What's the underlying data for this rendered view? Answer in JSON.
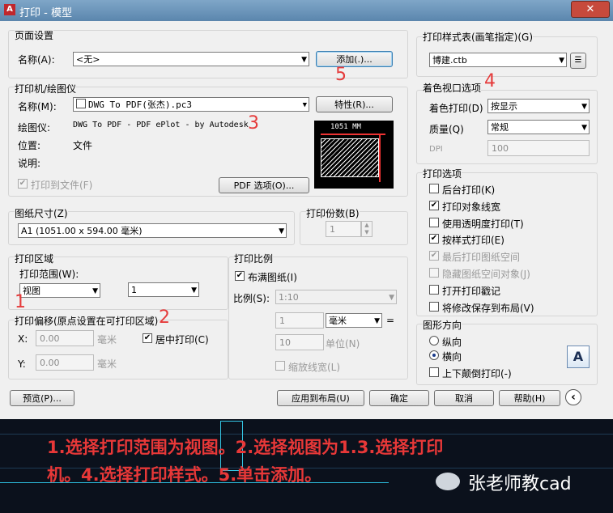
{
  "window": {
    "title": "打印 - 模型",
    "close": "✕"
  },
  "page_setup": {
    "group": "页面设置",
    "name_label": "名称(A):",
    "name_value": "<无>",
    "add_button": "添加(.)..."
  },
  "plotter": {
    "group": "打印机/绘图仪",
    "name_label": "名称(M):",
    "name_value": "DWG To PDF(张杰).pc3",
    "properties_button": "特性(R)...",
    "device_label": "绘图仪:",
    "device_value": "DWG To PDF - PDF ePlot - by Autodesk",
    "location_label": "位置:",
    "location_value": "文件",
    "desc_label": "说明:",
    "plot_to_file": "打印到文件(F)",
    "pdf_options": "PDF 选项(O)...",
    "preview_dim": "1051 MM"
  },
  "paper_size": {
    "group": "图纸尺寸(Z)",
    "value": "A1 (1051.00 x 594.00 毫米)"
  },
  "copies": {
    "label": "打印份数(B)",
    "value": "1"
  },
  "plot_area": {
    "group": "打印区域",
    "range_label": "打印范围(W):",
    "range_value": "视图",
    "view_value": "1"
  },
  "plot_offset": {
    "group": "打印偏移(原点设置在可打印区域)",
    "x_label": "X:",
    "x_value": "0.00",
    "x_unit": "毫米",
    "y_label": "Y:",
    "y_value": "0.00",
    "y_unit": "毫米",
    "center_label": "居中打印(C)"
  },
  "plot_scale": {
    "group": "打印比例",
    "fit_label": "布满图纸(I)",
    "scale_label": "比例(S):",
    "scale_value": "1:10",
    "val1": "1",
    "unit_value": "毫米",
    "eq": "=",
    "val2": "10",
    "unit_label": "单位(N)",
    "lineweights": "缩放线宽(L)"
  },
  "style_table": {
    "group": "打印样式表(画笔指定)(G)",
    "value": "博建.ctb"
  },
  "shaded": {
    "group": "着色视口选项",
    "shade_label": "着色打印(D)",
    "shade_value": "按显示",
    "quality_label": "质量(Q)",
    "quality_value": "常规",
    "dpi_label": "DPI",
    "dpi_value": "100"
  },
  "options": {
    "group": "打印选项",
    "items": [
      {
        "label": "后台打印(K)",
        "checked": "",
        "disabled": false
      },
      {
        "label": "打印对象线宽",
        "checked": "✔",
        "disabled": false
      },
      {
        "label": "使用透明度打印(T)",
        "checked": "",
        "disabled": false
      },
      {
        "label": "按样式打印(E)",
        "checked": "✔",
        "disabled": false
      },
      {
        "label": "最后打印图纸空间",
        "checked": "✔",
        "disabled": true
      },
      {
        "label": "隐藏图纸空间对象(J)",
        "checked": "",
        "disabled": true
      },
      {
        "label": "打开打印戳记",
        "checked": "",
        "disabled": false
      },
      {
        "label": "将修改保存到布局(V)",
        "checked": "",
        "disabled": false
      }
    ]
  },
  "orientation": {
    "group": "图形方向",
    "portrait": "纵向",
    "landscape": "横向",
    "upside": "上下颠倒打印(-)",
    "icon_letter": "A"
  },
  "footer": {
    "preview": "预览(P)...",
    "apply": "应用到布局(U)",
    "ok": "确定",
    "cancel": "取消",
    "help": "帮助(H)",
    "more": "‹"
  },
  "annotations": [
    "1",
    "2",
    "3",
    "4",
    "5"
  ],
  "caption": {
    "line1": "1.选择打印范围为视图。2.选择视图为1.3.选择打印",
    "line2": "机。4.选择打印样式。5.单击添加。"
  },
  "watermark": "张老师教cad",
  "colors": {
    "accent_red": "#e53b3b",
    "title_blue": "#5b86ad"
  }
}
